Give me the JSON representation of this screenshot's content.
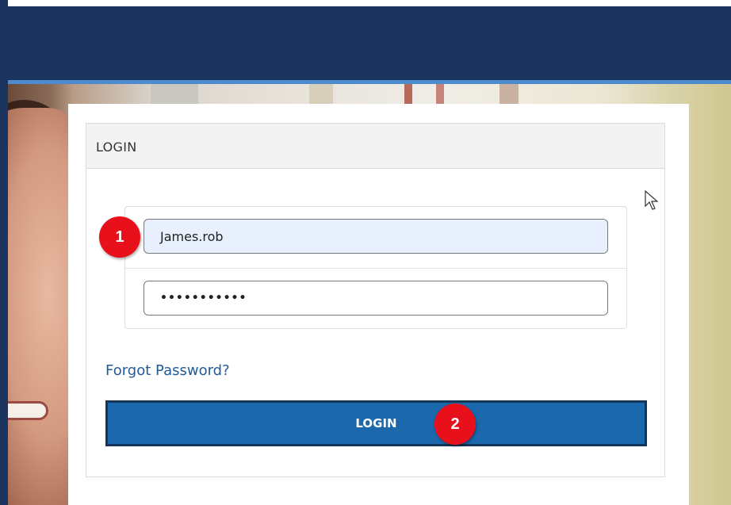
{
  "card": {
    "title": "LOGIN"
  },
  "form": {
    "username_value": "James.rob",
    "password_value": "•••••••••••",
    "forgot_link": "Forgot Password?",
    "login_button": "LOGIN"
  },
  "annotations": {
    "marker_1": "1",
    "marker_2": "2"
  },
  "colors": {
    "header": "#1b355e",
    "accent_stripe": "#4d8bcc",
    "button": "#1b68ad",
    "link": "#215a96",
    "marker": "#e8101a"
  }
}
